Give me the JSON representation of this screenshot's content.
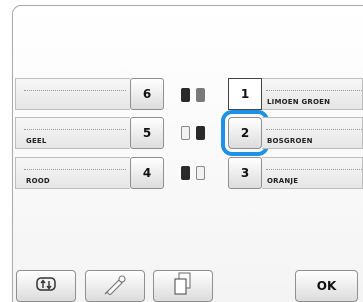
{
  "left_column": [
    {
      "number": "6",
      "color_name": ""
    },
    {
      "number": "5",
      "color_name": "GEEL"
    },
    {
      "number": "4",
      "color_name": "ROOD"
    }
  ],
  "right_column": [
    {
      "number": "1",
      "color_name": "LIMOEN GROEN",
      "state": "white"
    },
    {
      "number": "2",
      "color_name": "BOSGROEN",
      "state": "selected"
    },
    {
      "number": "3",
      "color_name": "ORANJE",
      "state": "normal"
    }
  ],
  "spool_pairs": [
    {
      "left": "dark",
      "right": "grey"
    },
    {
      "left": "light",
      "right": "dark"
    },
    {
      "left": "dark",
      "right": "light"
    }
  ],
  "colors": {
    "selection_highlight": "#1e90e6"
  },
  "bottom_toolbar": {
    "icons": [
      "thread-change-icon",
      "eyedropper-icon",
      "copy-icon"
    ],
    "ok_label": "OK"
  }
}
